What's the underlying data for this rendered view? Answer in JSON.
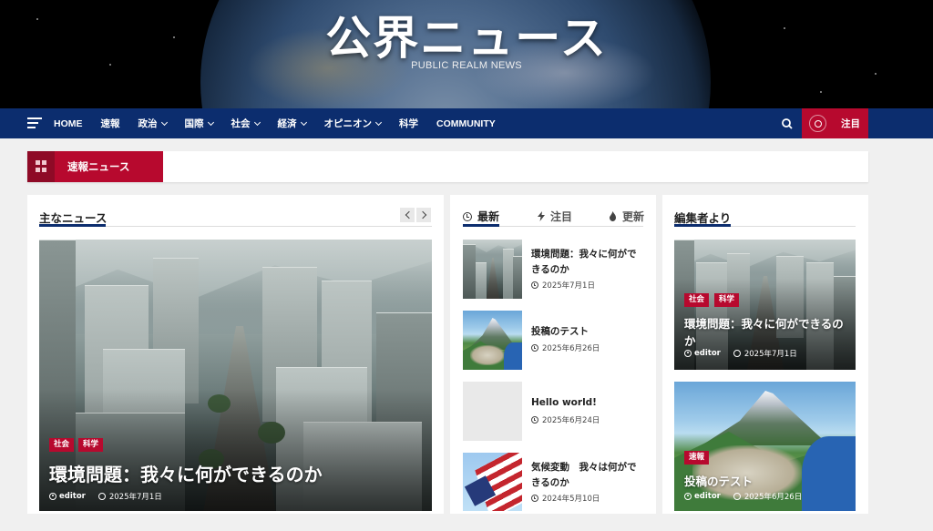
{
  "header": {
    "title": "公界ニュース",
    "subtitle": "PUBLIC REALM NEWS"
  },
  "nav": {
    "items": [
      {
        "label": "HOME",
        "dropdown": false
      },
      {
        "label": "速報",
        "dropdown": false
      },
      {
        "label": "政治",
        "dropdown": true
      },
      {
        "label": "国際",
        "dropdown": true
      },
      {
        "label": "社会",
        "dropdown": true
      },
      {
        "label": "経済",
        "dropdown": true
      },
      {
        "label": "オピニオン",
        "dropdown": true
      },
      {
        "label": "科学",
        "dropdown": false
      },
      {
        "label": "COMMUNITY",
        "dropdown": false
      }
    ],
    "trending_label": "注目"
  },
  "breaking": {
    "label": "速報ニュース"
  },
  "main_news": {
    "title": "主なニュース",
    "featured": {
      "categories": [
        "社会",
        "科学"
      ],
      "headline": "環境問題：我々に何ができるのか",
      "author": "editor",
      "date": "2025年7月1日"
    }
  },
  "tabs_panel": {
    "tabs": [
      {
        "label": "最新",
        "icon": "clock-icon",
        "active": true
      },
      {
        "label": "注目",
        "icon": "bolt-icon",
        "active": false
      },
      {
        "label": "更新",
        "icon": "fire-icon",
        "active": false
      }
    ],
    "items": [
      {
        "title": "環境問題：我々に何ができるのか",
        "date": "2025年7月1日",
        "thumb": "city"
      },
      {
        "title": "投稿のテスト",
        "date": "2025年6月26日",
        "thumb": "mountain"
      },
      {
        "title": "Hello world!",
        "date": "2025年6月24日",
        "thumb": "empty"
      },
      {
        "title": "気候変動　我々は何ができるのか",
        "date": "2024年5月10日",
        "thumb": "flag"
      }
    ]
  },
  "editor_panel": {
    "title": "編集者より",
    "cards": [
      {
        "categories": [
          "社会",
          "科学"
        ],
        "headline": "環境問題：我々に何ができるのか",
        "author": "editor",
        "date": "2025年7月1日"
      },
      {
        "categories": [
          "速報"
        ],
        "headline": "投稿のテスト",
        "author": "editor",
        "date": "2025年6月26日"
      }
    ]
  },
  "colors": {
    "nav_bg": "#0c2d6e",
    "accent_red": "#b7092e",
    "page_bg": "#f0f0f0"
  }
}
